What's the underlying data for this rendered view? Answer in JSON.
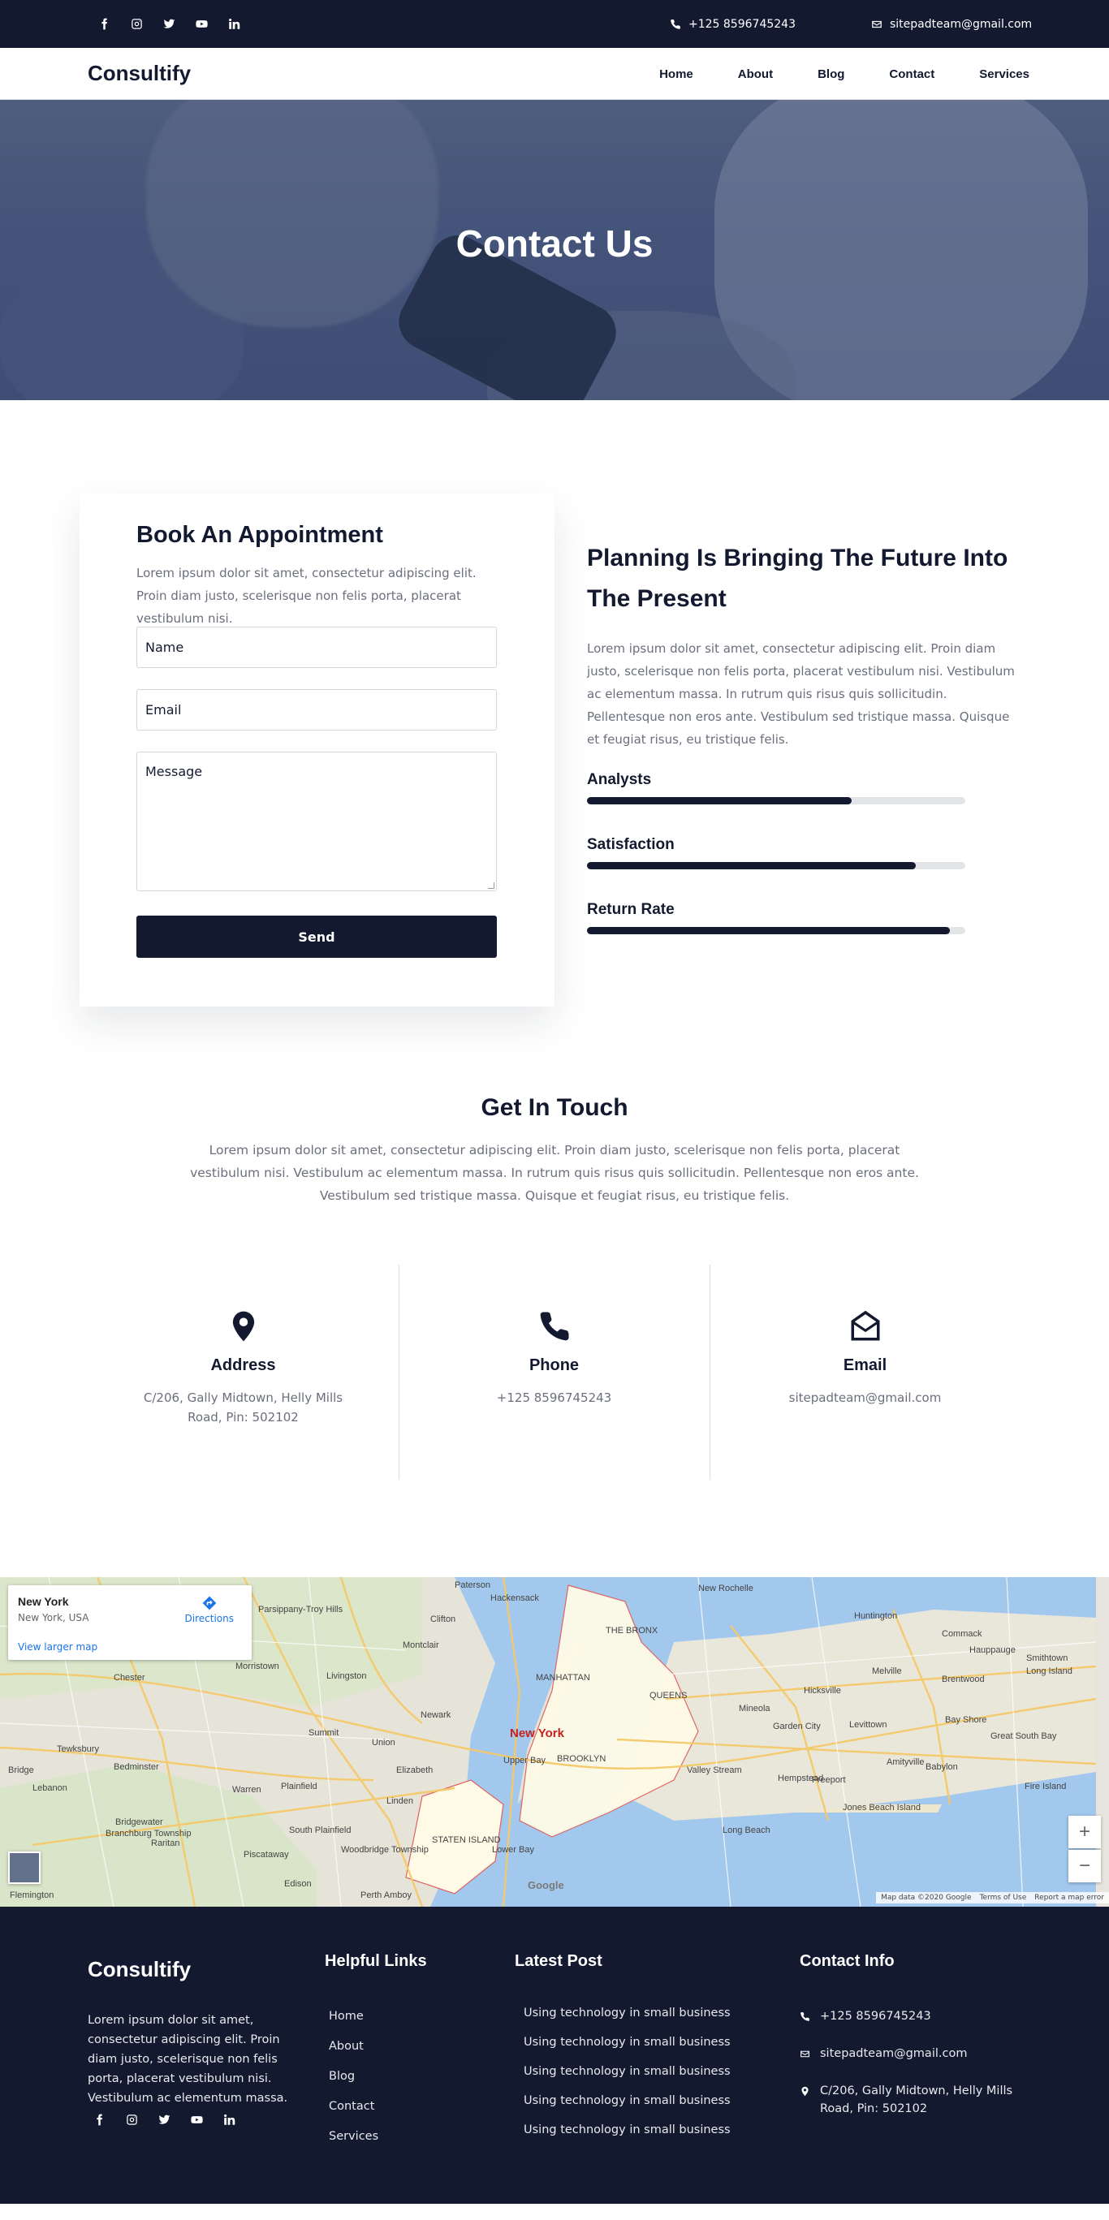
{
  "topbar": {
    "socials": [
      "facebook-icon",
      "instagram-icon",
      "twitter-icon",
      "youtube-icon",
      "linkedin-icon"
    ],
    "phone": "+125 8596745243",
    "email": "sitepadteam@gmail.com"
  },
  "nav": {
    "logo": "Consultify",
    "items": [
      "Home",
      "About",
      "Blog",
      "Contact",
      "Services"
    ]
  },
  "hero": {
    "title": "Contact Us"
  },
  "appointment": {
    "title": "Book An Appointment",
    "text": "Lorem ipsum dolor sit amet, consectetur adipiscing elit. Proin diam justo, scelerisque non felis porta, placerat vestibulum nisi.",
    "name_placeholder": "Name",
    "email_placeholder": "Email",
    "message_placeholder": "Message",
    "send_label": "Send"
  },
  "planning": {
    "title": "Planning Is Bringing The Future Into The Present",
    "text": "Lorem ipsum dolor sit amet, consectetur adipiscing elit. Proin diam justo, scelerisque non felis porta, placerat vestibulum nisi. Vestibulum ac elementum massa. In rutrum quis risus quis sollicitudin. Pellentesque non eros ante. Vestibulum sed tristique massa. Quisque et feugiat risus, eu tristique felis.",
    "skills": [
      {
        "label": "Analysts",
        "percent": 70
      },
      {
        "label": "Satisfaction",
        "percent": 87
      },
      {
        "label": "Return Rate",
        "percent": 96
      }
    ]
  },
  "touch": {
    "title": "Get In Touch",
    "text": "Lorem ipsum dolor sit amet, consectetur adipiscing elit. Proin diam justo, scelerisque non felis porta, placerat vestibulum nisi. Vestibulum ac elementum massa. In rutrum quis risus quis sollicitudin. Pellentesque non eros ante. Vestibulum sed tristique massa. Quisque et feugiat risus, eu tristique felis.",
    "items": [
      {
        "icon": "map-pin-icon",
        "title": "Address",
        "value": "C/206, Gally Midtown, Helly Mills Road, Pin: 502102"
      },
      {
        "icon": "phone-icon",
        "title": "Phone",
        "value": "+125 8596745243"
      },
      {
        "icon": "envelope-open-icon",
        "title": "Email",
        "value": "sitepadteam@gmail.com"
      }
    ]
  },
  "map": {
    "place_title": "New York",
    "place_subtitle": "New York, USA",
    "larger_map": "View larger map",
    "directions": "Directions",
    "city_label": "New York",
    "labels": [
      "Hackensack",
      "THE BRONX",
      "MANHATTAN",
      "QUEENS",
      "BROOKLYN",
      "STATEN ISLAND",
      "Newark",
      "Elizabeth",
      "Clifton",
      "Montclair",
      "Paterson",
      "Morristown",
      "Livingston",
      "Union",
      "Edison",
      "Hempstead",
      "Huntington",
      "Long Beach",
      "Jones Beach Island",
      "Mineola",
      "Hicksville",
      "Levittown",
      "Babylon",
      "Valley Stream",
      "New Rochelle",
      "Lower Bay",
      "Upper Bay",
      "Great South Bay",
      "Fire Island",
      "Bridgewater",
      "Plainfield",
      "Woodbridge Township",
      "Perth Amboy",
      "Flemington",
      "Tewksbury",
      "Chester",
      "Parsippany-Troy Hills",
      "Melville",
      "Commack",
      "Hauppauge",
      "Long Island",
      "Smithtown",
      "Brentwood",
      "Bay Shore",
      "Amityville",
      "Freeport",
      "Garden City",
      "Bedminster",
      "Warren",
      "Summit",
      "South Plainfield",
      "Piscataway",
      "Linden",
      "Branchburg Township",
      "Raritan",
      "Lebanon",
      "Bridge"
    ],
    "attribution": [
      "Map data ©2020 Google",
      "Terms of Use",
      "Report a map error"
    ],
    "google": "Google",
    "zoom_in": "+",
    "zoom_out": "−"
  },
  "footer": {
    "logo": "Consultify",
    "about": "Lorem ipsum dolor sit amet, consectetur adipiscing elit. Proin diam justo, scelerisque non felis porta, placerat vestibulum nisi. Vestibulum ac elementum massa.",
    "links_title": "Helpful Links",
    "links": [
      "Home",
      "About",
      "Blog",
      "Contact",
      "Services"
    ],
    "posts_title": "Latest Post",
    "posts": [
      "Using technology in small business",
      "Using technology in small business",
      "Using technology in small business",
      "Using technology in small business",
      "Using technology in small business"
    ],
    "contact_title": "Contact Info",
    "phone": "+125 8596745243",
    "email": "sitepadteam@gmail.com",
    "address": "C/206, Gally Midtown, Helly Mills Road, Pin: 502102"
  },
  "colors": {
    "navy": "#131a30",
    "text_gray": "#6b6f7d",
    "track": "#e3e4e8",
    "link_blue": "#1a73e8"
  }
}
